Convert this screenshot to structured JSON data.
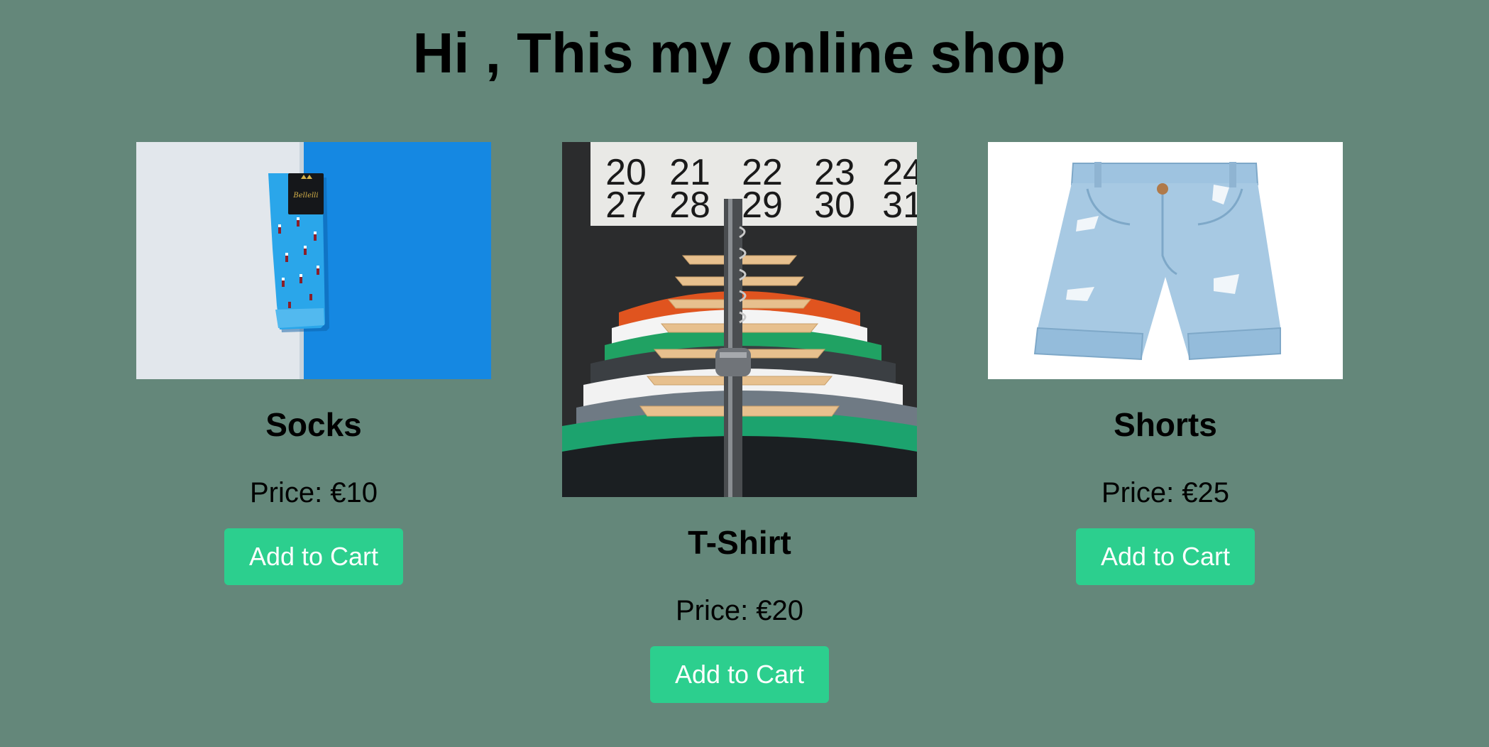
{
  "header": {
    "title": "Hi , This my online shop"
  },
  "products": [
    {
      "name": "Socks",
      "price": "Price: €10",
      "button_label": "Add to Cart",
      "image_label": "Bellelli"
    },
    {
      "name": "T-Shirt",
      "price": "Price: €20",
      "button_label": "Add to Cart",
      "image_calendar_row1": [
        "20",
        "21",
        "22",
        "23",
        "24"
      ],
      "image_calendar_row2": [
        "27",
        "28",
        "29",
        "30",
        "31"
      ]
    },
    {
      "name": "Shorts",
      "price": "Price: €25",
      "button_label": "Add to Cart"
    }
  ],
  "colors": {
    "background": "#64877a",
    "button": "#2ccf8e"
  }
}
